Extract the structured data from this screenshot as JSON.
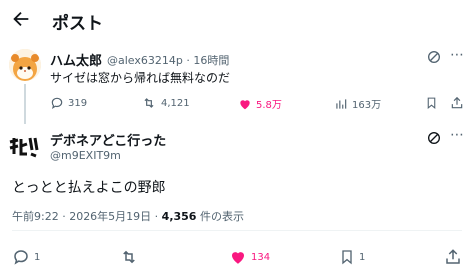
{
  "header": {
    "title": "ポスト"
  },
  "tweet1": {
    "author_name": "ハム太郎",
    "handle": "@alex63214p",
    "time": "16時間",
    "text": "サイゼは窓から帰れば無料なのだ",
    "replies": "319",
    "reposts": "4,121",
    "likes": "5.8万",
    "views": "163万",
    "like_color": "#f91880"
  },
  "tweet2": {
    "author_name": "デボネアどこ行った",
    "handle": "@m9EXIT9m",
    "text": "とっとと払えよこの野郎",
    "timestamp": "午前9:22 · 2026年5月19日 · ",
    "view_count": "4,356",
    "view_suffix": " 件の表示",
    "replies": "1",
    "reposts": "",
    "likes": "134",
    "bookmarks": "1",
    "like_color": "#f91880"
  }
}
